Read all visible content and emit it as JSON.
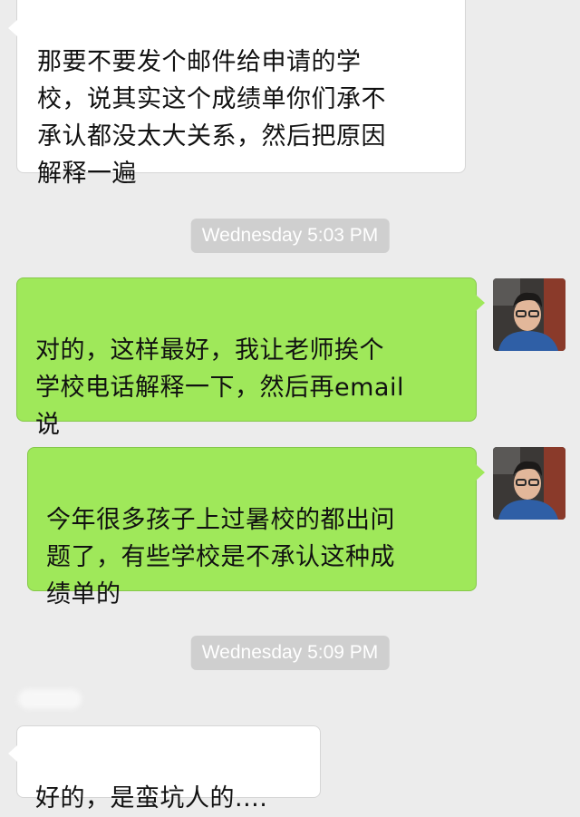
{
  "chat": {
    "messages": [
      {
        "side": "in",
        "text": "那要不要发个邮件给申请的学\n校，说其实这个成绩单你们承不\n承认都没太大关系，然后把原因\n解释一遍"
      },
      {
        "side": "out",
        "text": "对的，这样最好，我让老师挨个\n学校电话解释一下，然后再email\n说"
      },
      {
        "side": "out",
        "text": "今年很多孩子上过暑校的都出问\n题了，有些学校是不承认这种成\n绩单的"
      },
      {
        "side": "in",
        "text": "好的，是蛮坑人的...."
      }
    ],
    "timestamps": [
      "Wednesday 5:03 PM",
      "Wednesday 5:09 PM"
    ]
  },
  "colors": {
    "background": "#ececec",
    "incoming_bubble": "#ffffff",
    "outgoing_bubble": "#9fe85a",
    "timestamp_bg": "#cfcfcf"
  },
  "icons": {
    "avatar": "user-avatar-icon"
  }
}
